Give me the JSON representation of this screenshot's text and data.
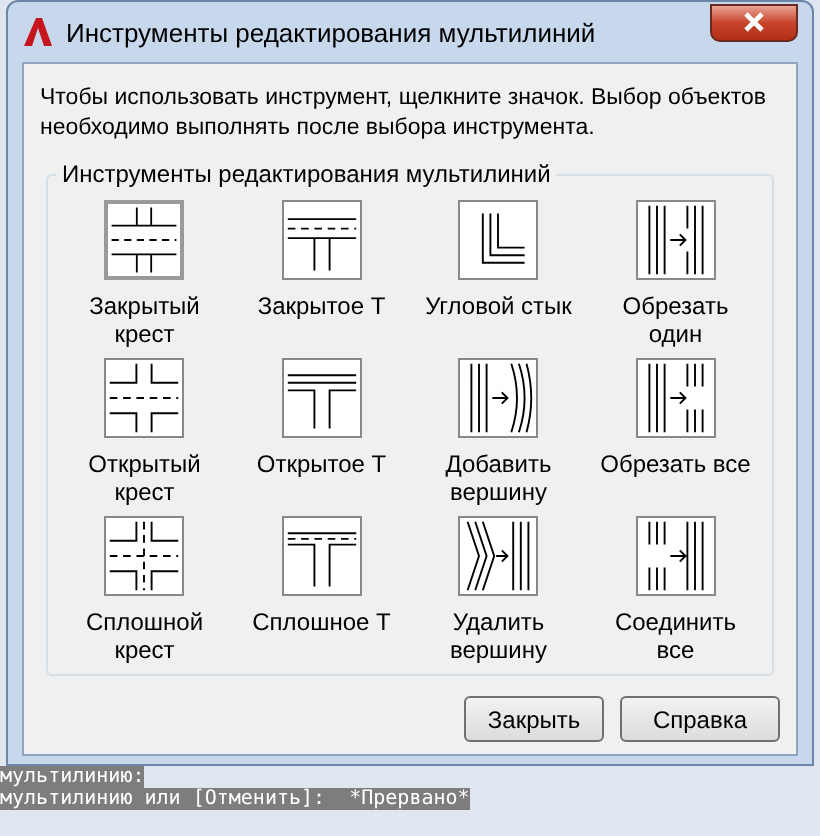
{
  "window": {
    "title": "Инструменты редактирования мультилиний"
  },
  "instructions": "Чтобы использовать инструмент, щелкните значок. Выбор объектов необходимо выполнять после выбора инструмента.",
  "group": {
    "title": "Инструменты редактирования мультилиний",
    "tools": [
      {
        "kind": "closed_cross",
        "label": "Закрытый крест",
        "selected": true
      },
      {
        "kind": "closed_tee",
        "label": "Закрытое Т",
        "selected": false
      },
      {
        "kind": "corner_joint",
        "label": "Угловой стык",
        "selected": false
      },
      {
        "kind": "cut_single",
        "label": "Обрезать один",
        "selected": false
      },
      {
        "kind": "open_cross",
        "label": "Открытый крест",
        "selected": false
      },
      {
        "kind": "open_tee",
        "label": "Открытое Т",
        "selected": false
      },
      {
        "kind": "add_vertex",
        "label": "Добавить вершину",
        "selected": false
      },
      {
        "kind": "cut_all",
        "label": "Обрезать все",
        "selected": false
      },
      {
        "kind": "merged_cross",
        "label": "Сплошной крест",
        "selected": false
      },
      {
        "kind": "merged_tee",
        "label": "Сплошное Т",
        "selected": false
      },
      {
        "kind": "delete_vertex",
        "label": "Удалить вершину",
        "selected": false
      },
      {
        "kind": "weld_all",
        "label": "Соединить все",
        "selected": false
      }
    ]
  },
  "buttons": [
    "Закрыть",
    "Справка"
  ],
  "command_lines": [
    "мультилинию:",
    "мультилинию или [Отменить]:  *Прервано*"
  ]
}
